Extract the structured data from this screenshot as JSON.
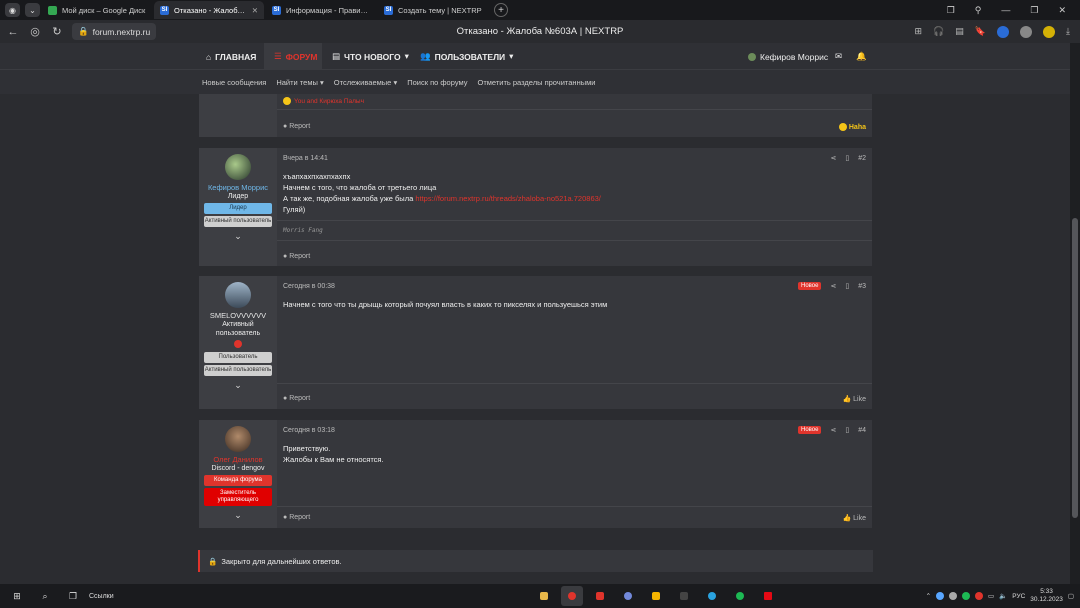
{
  "browser": {
    "tabs": [
      {
        "label": "Мой диск – Google Диск",
        "color": "#34a853",
        "fav": ""
      },
      {
        "label": "Отказано - Жалоба №603А | NEXTRP",
        "color": "#2a6cd6",
        "fav": "SI",
        "active": true
      },
      {
        "label": "Информация - Правила сервера",
        "color": "#2a6cd6",
        "fav": "SI"
      },
      {
        "label": "Создать тему | NEXTRP",
        "color": "#2a6cd6",
        "fav": "SI"
      }
    ],
    "url": "forum.nextrp.ru",
    "page_title": "Отказано - Жалоба №603А | NEXTRP"
  },
  "nav": {
    "home": "ГЛАВНАЯ",
    "forums": "ФОРУМ",
    "whats_new": "ЧТО НОВОГО",
    "members": "ПОЛЬЗОВАТЕЛИ",
    "user": "Кефиров Моррис"
  },
  "subnav": [
    "Новые сообщения",
    "Найти темы",
    "Отслеживаемые",
    "Поиск по форуму",
    "Отметить разделы прочитанными"
  ],
  "prev_post": {
    "reactions": "You and Кирюха Палыч",
    "report": "Report",
    "reaction_label": "Haha"
  },
  "posts": [
    {
      "author": "Кефиров Моррис",
      "author_color": "#6fb7e8",
      "title": "Лидер",
      "badges": [
        {
          "t": "Лидер",
          "bg": "#6fb7e8",
          "c": "#173349"
        },
        {
          "t": "Активный пользователь",
          "bg": "#cfcfcf",
          "c": "#333"
        }
      ],
      "time": "Вчера в 14:41",
      "num": "#2",
      "lines": [
        "хъапхахпхахпхахпх",
        "Начнем с того, что жалоба от третьего лица",
        "А так же, подобная жалоба уже была ",
        "Гуляй)"
      ],
      "link": "https://forum.nextrp.ru/threads/zhaloba-no521a.720863/",
      "signature": "Morris Fang",
      "report": "Report"
    },
    {
      "author": "SMELOVVVVVV",
      "author_color": "#ddd",
      "title": "Активный пользователь",
      "badges": [
        {
          "t": "Пользователь",
          "bg": "#cfcfcf",
          "c": "#333"
        },
        {
          "t": "Активный пользователь",
          "bg": "#cfcfcf",
          "c": "#333"
        }
      ],
      "time": "Сегодня в 00:38",
      "num": "#3",
      "new": "Новое",
      "lines": [
        "Начнем с того что ты дрыщь который почуял власть в каких то пикселях и пользуешься этим"
      ],
      "report": "Report",
      "like": "Like"
    },
    {
      "author": "Олег Данилов",
      "author_color": "#e0342c",
      "title": "Discord - dengov",
      "badges": [
        {
          "t": "Команда форума",
          "bg": "#e0342c",
          "c": "#fff"
        },
        {
          "t": "Заместитель управляющего",
          "bg": "#e00000",
          "c": "#fff"
        }
      ],
      "time": "Сегодня в 03:18",
      "num": "#4",
      "new": "Новое",
      "lines": [
        "Приветствую.",
        "Жалобы к Вам не относятся."
      ],
      "report": "Report",
      "like": "Like"
    }
  ],
  "closed": "Закрыто для дальнейших ответов.",
  "taskbar": {
    "search": "Ссылки",
    "lang": "РУС",
    "time": "5:33",
    "date": "30.12.2023"
  }
}
